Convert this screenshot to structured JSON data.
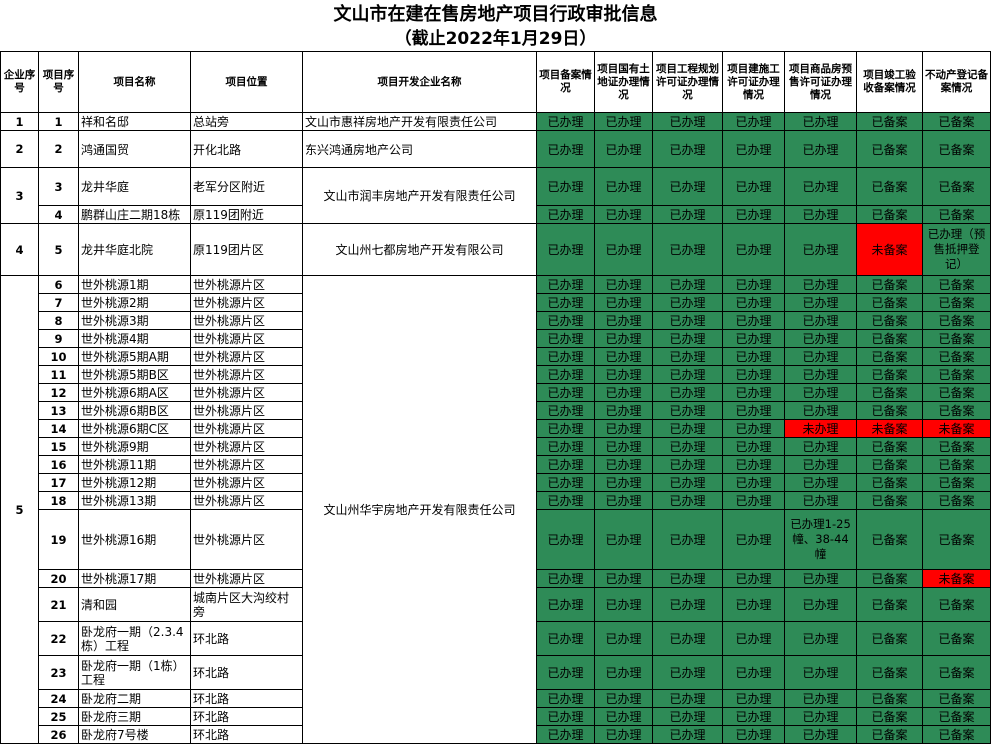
{
  "title": "文山市在建在售房地产项目行政审批信息",
  "subtitle": "（截止2022年1月29日）",
  "headers": {
    "company_no": "企业序号",
    "project_no": "项目序号",
    "project_name": "项目名称",
    "location": "项目位置",
    "developer": "项目开发企业名称",
    "record": "项目备案情况",
    "land": "项目国有土地证办理情况",
    "planning": "项目工程规划许可证办理情况",
    "construction": "项目建施工许可证办理情况",
    "presale": "项目商品房预售许可证办理情况",
    "completion": "项目竣工验收备案情况",
    "property": "不动产登记备案情况"
  },
  "companies": [
    {
      "no": "1",
      "developer": "文山市惠祥房地产开发有限责任公司"
    },
    {
      "no": "2",
      "developer": "东兴鸿通房地产公司"
    },
    {
      "no": "3",
      "developer": "文山市润丰房地产开发有限责任公司"
    },
    {
      "no": "4",
      "developer": "文山州七都房地产开发有限公司"
    },
    {
      "no": "5",
      "developer": "文山州华宇房地产开发有限责任公司"
    }
  ],
  "rows": [
    {
      "no": "1",
      "name": "祥和名邸",
      "loc": "总站旁",
      "s": [
        "已办理",
        "已办理",
        "已办理",
        "已办理",
        "已办理",
        "已备案",
        "已备案"
      ]
    },
    {
      "no": "2",
      "name": "鸿通国贸",
      "loc": "开化北路",
      "s": [
        "已办理",
        "已办理",
        "已办理",
        "已办理",
        "已办理",
        "已备案",
        "已备案"
      ]
    },
    {
      "no": "3",
      "name": "龙井华庭",
      "loc": "老军分区附近",
      "s": [
        "已办理",
        "已办理",
        "已办理",
        "已办理",
        "已办理",
        "已备案",
        "已备案"
      ]
    },
    {
      "no": "4",
      "name": "鹏群山庄二期18栋",
      "loc": "原119团附近",
      "s": [
        "已办理",
        "已办理",
        "已办理",
        "已办理",
        "已办理",
        "已备案",
        "已备案"
      ]
    },
    {
      "no": "5",
      "name": "龙井华庭北院",
      "loc": "原119团片区",
      "s": [
        "已办理",
        "已办理",
        "已办理",
        "已办理",
        "已办理",
        "未备案",
        "已办理（预售抵押登记）"
      ]
    },
    {
      "no": "6",
      "name": "世外桃源1期",
      "loc": "世外桃源片区",
      "s": [
        "已办理",
        "已办理",
        "已办理",
        "已办理",
        "已办理",
        "已备案",
        "已备案"
      ]
    },
    {
      "no": "7",
      "name": "世外桃源2期",
      "loc": "世外桃源片区",
      "s": [
        "已办理",
        "已办理",
        "已办理",
        "已办理",
        "已办理",
        "已备案",
        "已备案"
      ]
    },
    {
      "no": "8",
      "name": "世外桃源3期",
      "loc": "世外桃源片区",
      "s": [
        "已办理",
        "已办理",
        "已办理",
        "已办理",
        "已办理",
        "已备案",
        "已备案"
      ]
    },
    {
      "no": "9",
      "name": "世外桃源4期",
      "loc": "世外桃源片区",
      "s": [
        "已办理",
        "已办理",
        "已办理",
        "已办理",
        "已办理",
        "已备案",
        "已备案"
      ]
    },
    {
      "no": "10",
      "name": "世外桃源5期A期",
      "loc": "世外桃源片区",
      "s": [
        "已办理",
        "已办理",
        "已办理",
        "已办理",
        "已办理",
        "已备案",
        "已备案"
      ]
    },
    {
      "no": "11",
      "name": "世外桃源5期B区",
      "loc": "世外桃源片区",
      "s": [
        "已办理",
        "已办理",
        "已办理",
        "已办理",
        "已办理",
        "已备案",
        "已备案"
      ]
    },
    {
      "no": "12",
      "name": "世外桃源6期A区",
      "loc": "世外桃源片区",
      "s": [
        "已办理",
        "已办理",
        "已办理",
        "已办理",
        "已办理",
        "已备案",
        "已备案"
      ]
    },
    {
      "no": "13",
      "name": "世外桃源6期B区",
      "loc": "世外桃源片区",
      "s": [
        "已办理",
        "已办理",
        "已办理",
        "已办理",
        "已办理",
        "已备案",
        "已备案"
      ]
    },
    {
      "no": "14",
      "name": "世外桃源6期C区",
      "loc": "世外桃源片区",
      "s": [
        "已办理",
        "已办理",
        "已办理",
        "已办理",
        "未办理",
        "未备案",
        "未备案"
      ]
    },
    {
      "no": "15",
      "name": "世外桃源9期",
      "loc": "世外桃源片区",
      "s": [
        "已办理",
        "已办理",
        "已办理",
        "已办理",
        "已办理",
        "已备案",
        "已备案"
      ]
    },
    {
      "no": "16",
      "name": "世外桃源11期",
      "loc": "世外桃源片区",
      "s": [
        "已办理",
        "已办理",
        "已办理",
        "已办理",
        "已办理",
        "已备案",
        "已备案"
      ]
    },
    {
      "no": "17",
      "name": "世外桃源12期",
      "loc": "世外桃源片区",
      "s": [
        "已办理",
        "已办理",
        "已办理",
        "已办理",
        "已办理",
        "已备案",
        "已备案"
      ]
    },
    {
      "no": "18",
      "name": "世外桃源13期",
      "loc": "世外桃源片区",
      "s": [
        "已办理",
        "已办理",
        "已办理",
        "已办理",
        "已办理",
        "已备案",
        "已备案"
      ]
    },
    {
      "no": "19",
      "name": "世外桃源16期",
      "loc": "世外桃源片区",
      "s": [
        "已办理",
        "已办理",
        "已办理",
        "已办理",
        "已办理1-25幢、38-44幢",
        "已备案",
        "已备案"
      ]
    },
    {
      "no": "20",
      "name": "世外桃源17期",
      "loc": "世外桃源片区",
      "s": [
        "已办理",
        "已办理",
        "已办理",
        "已办理",
        "已办理",
        "已备案",
        "未备案"
      ]
    },
    {
      "no": "21",
      "name": "清和园",
      "loc": "城南片区大沟绞村旁",
      "s": [
        "已办理",
        "已办理",
        "已办理",
        "已办理",
        "已办理",
        "已备案",
        "已备案"
      ]
    },
    {
      "no": "22",
      "name": "卧龙府一期（2.3.4栋）工程",
      "loc": "环北路",
      "s": [
        "已办理",
        "已办理",
        "已办理",
        "已办理",
        "已办理",
        "已备案",
        "已备案"
      ]
    },
    {
      "no": "23",
      "name": "卧龙府一期（1栋）工程",
      "loc": "环北路",
      "s": [
        "已办理",
        "已办理",
        "已办理",
        "已办理",
        "已办理",
        "已备案",
        "已备案"
      ]
    },
    {
      "no": "24",
      "name": "卧龙府二期",
      "loc": "环北路",
      "s": [
        "已办理",
        "已办理",
        "已办理",
        "已办理",
        "已办理",
        "已备案",
        "已备案"
      ]
    },
    {
      "no": "25",
      "name": "卧龙府三期",
      "loc": "环北路",
      "s": [
        "已办理",
        "已办理",
        "已办理",
        "已办理",
        "已办理",
        "已备案",
        "已备案"
      ]
    },
    {
      "no": "26",
      "name": "卧龙府7号楼",
      "loc": "环北路",
      "s": [
        "已办理",
        "已办理",
        "已办理",
        "已办理",
        "已办理",
        "已备案",
        "已备案"
      ]
    }
  ],
  "colors": {
    "done": "#2e8b57",
    "not_done": "#ff0000"
  }
}
